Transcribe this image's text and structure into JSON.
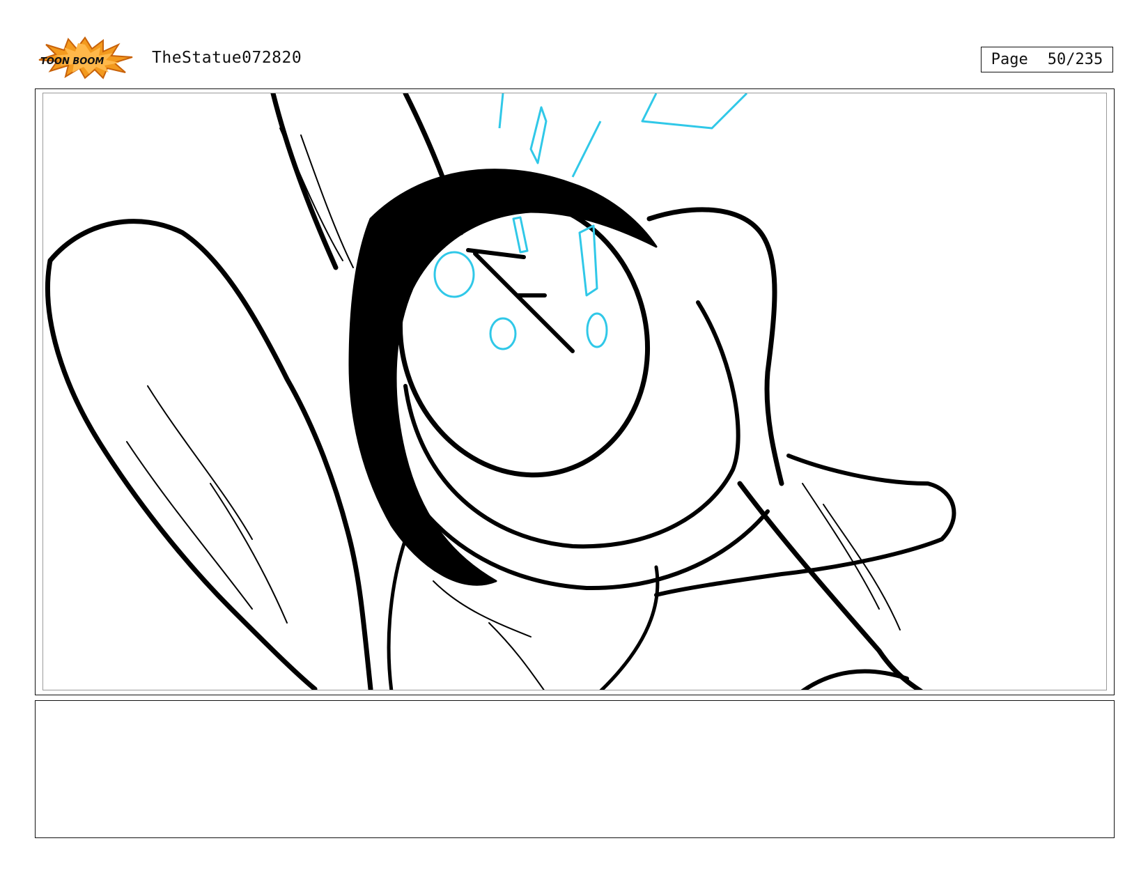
{
  "header": {
    "logo": {
      "text": "TOON BOOM",
      "icon": "toonboom-starburst-logo",
      "colors": {
        "burst": "#f39a1e",
        "burst_dark": "#c8620a",
        "text": "#111111"
      }
    },
    "project_title": "TheStatue072820",
    "page_label": "Page",
    "page_number": "50/235"
  },
  "panel": {
    "name": "storyboard-panel-50",
    "sketch_colors": {
      "ink": "#000000",
      "effect": "#30c8e8"
    }
  },
  "notes": {
    "text": ""
  }
}
